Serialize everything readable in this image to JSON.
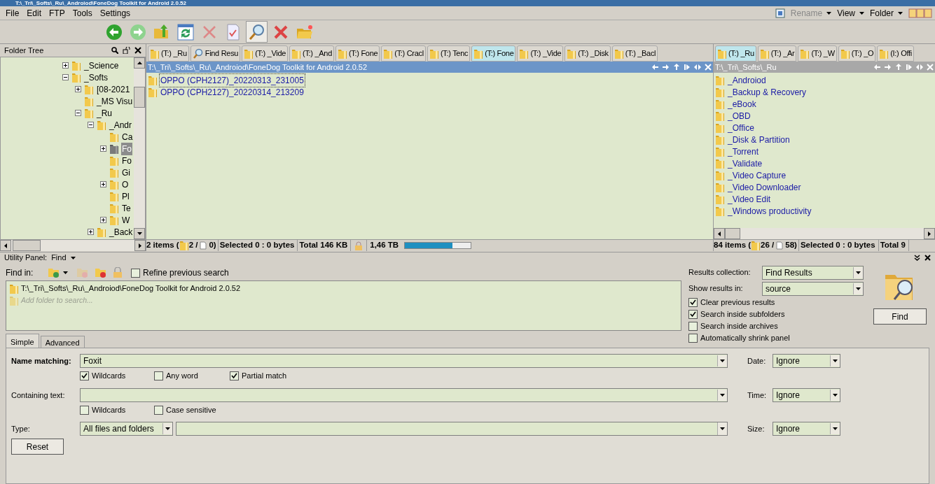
{
  "window": {
    "title": "T:\\_Tri\\_Softs\\_Ru\\_Androiod\\FoneDog Toolkit for Android 2.0.52"
  },
  "menu": [
    "File",
    "Edit",
    "FTP",
    "Tools",
    "Settings"
  ],
  "menu_right": [
    {
      "label": "Rename",
      "disabled": true
    },
    {
      "label": "View",
      "disabled": false
    },
    {
      "label": "Folder",
      "disabled": false
    }
  ],
  "folder_tree": {
    "title": "Folder Tree",
    "items": [
      {
        "label": "_Science",
        "expanded": false,
        "selected": false
      },
      {
        "label": "_Softs",
        "expanded": true,
        "selected": false,
        "children": [
          {
            "label": "[08-2021",
            "expanded": false,
            "selected": false
          },
          {
            "label": "_MS Visu",
            "selected": false
          },
          {
            "label": "_Ru",
            "expanded": true,
            "selected": false,
            "children": [
              {
                "label": "_Andr",
                "expanded": true,
                "selected": false,
                "children": [
                  {
                    "label": "Ca",
                    "selected": false
                  },
                  {
                    "label": "Fo",
                    "expanded": false,
                    "selected": true
                  },
                  {
                    "label": "Fo",
                    "selected": false
                  },
                  {
                    "label": "Gi",
                    "selected": false
                  },
                  {
                    "label": "O",
                    "expanded": false,
                    "selected": false
                  },
                  {
                    "label": "Pl",
                    "selected": false
                  },
                  {
                    "label": "Te",
                    "selected": false
                  },
                  {
                    "label": "W",
                    "expanded": false,
                    "selected": false
                  }
                ]
              },
              {
                "label": "_Back",
                "expanded": false,
                "selected": false
              }
            ]
          }
        ]
      }
    ]
  },
  "left_pane": {
    "tabs": [
      {
        "label": "(T:) _Ru",
        "kind": "folder",
        "selected": false
      },
      {
        "label": "Find Resu",
        "kind": "search",
        "selected": false
      },
      {
        "label": "(T:) _Vide",
        "kind": "folder",
        "selected": false
      },
      {
        "label": "(T:) _And",
        "kind": "folder",
        "selected": false
      },
      {
        "label": "(T:) Fone",
        "kind": "folder",
        "selected": false
      },
      {
        "label": "(T:) Cracl",
        "kind": "folder",
        "selected": false
      },
      {
        "label": "(T:) Tenc",
        "kind": "folder",
        "selected": false
      },
      {
        "label": "(T:) Fone",
        "kind": "folder",
        "selected": true
      },
      {
        "label": "(T:) _Vide",
        "kind": "folder",
        "selected": false
      },
      {
        "label": "(T:) _Disk",
        "kind": "folder",
        "selected": false
      },
      {
        "label": "(T:) _Bacl",
        "kind": "folder",
        "selected": false
      }
    ],
    "path": "T:\\_Tri\\_Softs\\_Ru\\_Androiod\\FoneDog Toolkit for Android 2.0.52",
    "active": true,
    "files": [
      {
        "name": "OPPO (CPH2127)_20220313_231005",
        "focused": true
      },
      {
        "name": "OPPO (CPH2127)_20220314_213209",
        "focused": false
      }
    ],
    "status": {
      "items": "2 items (",
      "folders": "2 /",
      "files": "0)",
      "selected": "Selected 0 : 0 bytes",
      "total": "Total 146 KB",
      "free": "1,46 TB",
      "level": 0.72
    }
  },
  "right_pane": {
    "tabs": [
      {
        "label": "(T:) _Ru",
        "kind": "folder",
        "selected": true
      },
      {
        "label": "(T:) _Ar",
        "kind": "folder",
        "selected": false
      },
      {
        "label": "(T:) _W",
        "kind": "folder",
        "selected": false
      },
      {
        "label": "(T:) _O",
        "kind": "folder",
        "selected": false
      },
      {
        "label": "(I:) Offi",
        "kind": "folder",
        "selected": false
      }
    ],
    "path": "T:\\_Tri\\_Softs\\_Ru",
    "active": false,
    "files": [
      {
        "name": "_Androiod",
        "focused": false
      },
      {
        "name": "_Backup & Recovery",
        "focused": false
      },
      {
        "name": "_eBook",
        "focused": false
      },
      {
        "name": "_OBD",
        "focused": false
      },
      {
        "name": "_Office",
        "focused": false
      },
      {
        "name": "_Disk & Partition",
        "focused": false
      },
      {
        "name": "_Torrent",
        "focused": false
      },
      {
        "name": "_Validate",
        "focused": false
      },
      {
        "name": "_Video Capture",
        "focused": false
      },
      {
        "name": "_Video Downloader",
        "focused": false
      },
      {
        "name": "_Video Edit",
        "focused": false
      },
      {
        "name": "_Windows productivity",
        "focused": false
      }
    ],
    "status": {
      "items": "84 items (",
      "folders": "26 /",
      "files": "58)",
      "selected": "Selected 0 : 0 bytes",
      "total": "Total 9"
    }
  },
  "utility_panel": {
    "label": "Utility Panel:",
    "mode": "Find",
    "find_in_label": "Find in:",
    "refine": {
      "label": "Refine previous search",
      "checked": false
    },
    "folders": [
      "T:\\_Tri\\_Softs\\_Ru\\_Androiod\\FoneDog Toolkit for Android 2.0.52"
    ],
    "add_placeholder": "Add folder to search...",
    "results_collection": {
      "label": "Results collection:",
      "value": "Find Results"
    },
    "show_results_in": {
      "label": "Show results in:",
      "value": "source"
    },
    "options": [
      {
        "label": "Clear previous results",
        "checked": true
      },
      {
        "label": "Search inside subfolders",
        "checked": true
      },
      {
        "label": "Search inside archives",
        "checked": false
      },
      {
        "label": "Automatically shrink panel",
        "checked": false
      }
    ],
    "find_button": "Find",
    "tabs": [
      {
        "label": "Simple",
        "selected": true
      },
      {
        "label": "Advanced",
        "selected": false
      }
    ],
    "name_matching": {
      "label": "Name matching:",
      "value": "Foxit",
      "options": [
        {
          "label": "Wildcards",
          "checked": true
        },
        {
          "label": "Any word",
          "checked": false
        },
        {
          "label": "Partial match",
          "checked": true
        }
      ]
    },
    "containing_text": {
      "label": "Containing text:",
      "options": [
        {
          "label": "Wildcards",
          "checked": false
        },
        {
          "label": "Case sensitive",
          "checked": false
        }
      ]
    },
    "type": {
      "label": "Type:",
      "value": "All files and folders"
    },
    "date": {
      "label": "Date:",
      "value": "Ignore"
    },
    "time": {
      "label": "Time:",
      "value": "Ignore"
    },
    "size": {
      "label": "Size:",
      "value": "Ignore"
    },
    "reset_button": "Reset"
  }
}
